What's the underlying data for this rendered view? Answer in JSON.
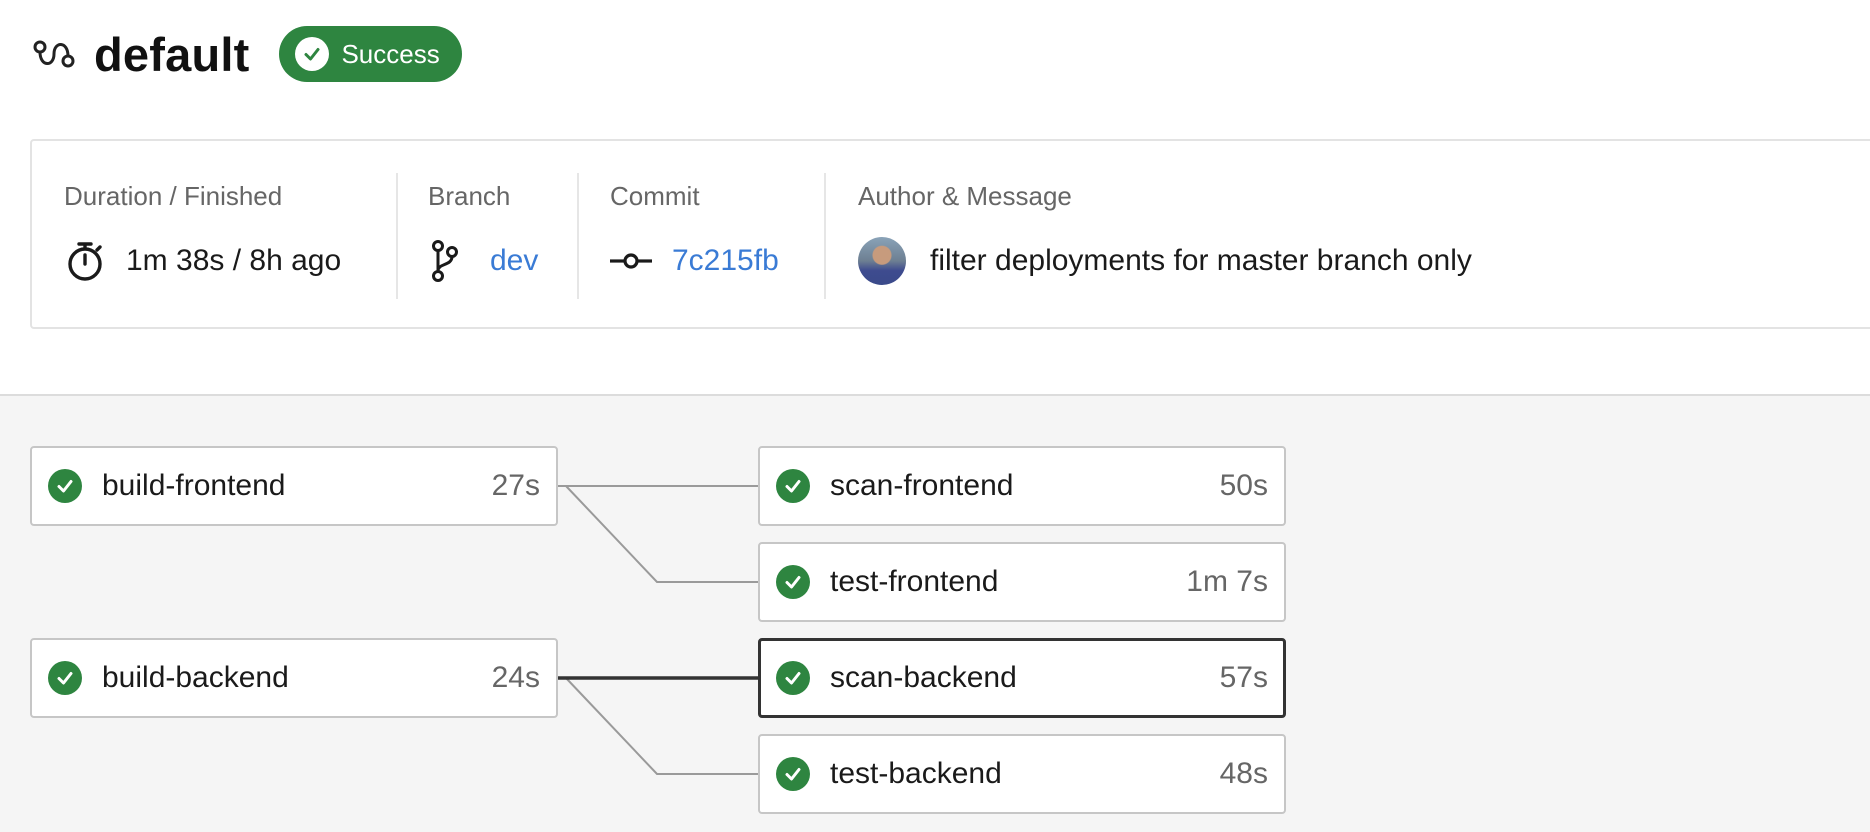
{
  "pipeline": {
    "title": "default",
    "status_label": "Success",
    "status_color": "#2e8540",
    "icon": "pipeline-icon"
  },
  "info": {
    "duration": {
      "label": "Duration / Finished",
      "value": "1m 38s / 8h ago",
      "icon": "stopwatch-icon"
    },
    "branch": {
      "label": "Branch",
      "value": "dev",
      "icon": "branch-icon"
    },
    "commit": {
      "label": "Commit",
      "value": "7c215fb",
      "icon": "commit-icon"
    },
    "author": {
      "label": "Author & Message",
      "message": "filter deployments for master branch only",
      "icon": "avatar"
    }
  },
  "stages": [
    {
      "name": "build-frontend",
      "duration": "27s",
      "status": "success"
    },
    {
      "name": "build-backend",
      "duration": "24s",
      "status": "success"
    },
    {
      "name": "scan-frontend",
      "duration": "50s",
      "status": "success"
    },
    {
      "name": "test-frontend",
      "duration": "1m 7s",
      "status": "success"
    },
    {
      "name": "scan-backend",
      "duration": "57s",
      "status": "success",
      "selected": true
    },
    {
      "name": "test-backend",
      "duration": "48s",
      "status": "success"
    }
  ],
  "colors": {
    "link": "#3a7bd5",
    "success": "#2e8540"
  }
}
